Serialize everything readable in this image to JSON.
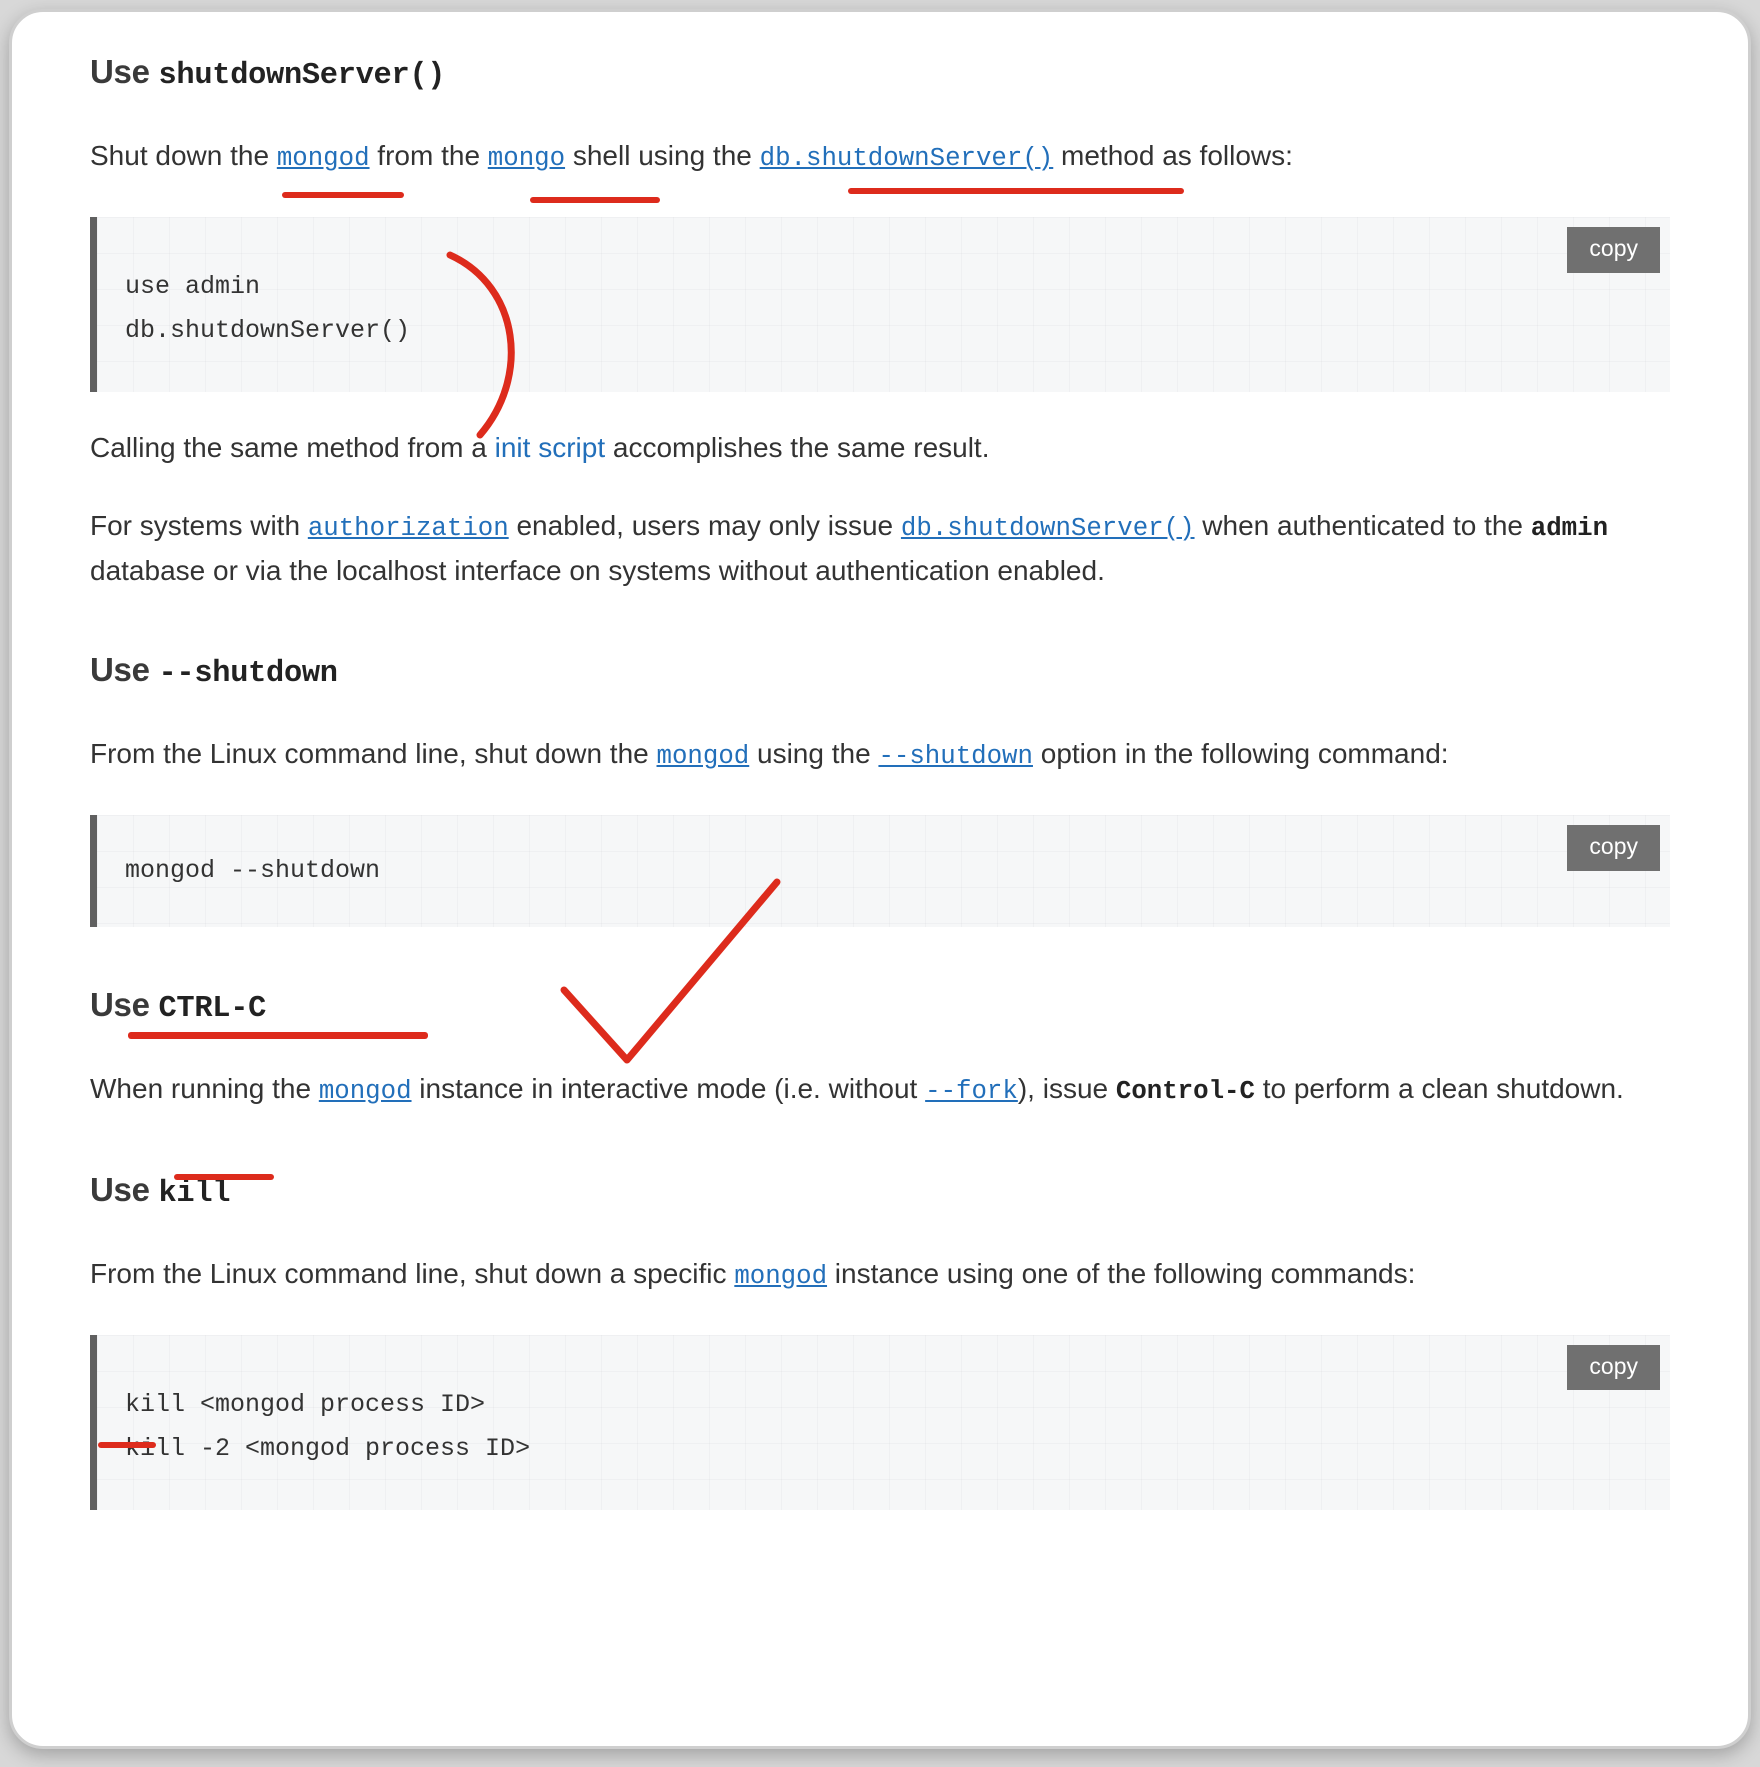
{
  "s1": {
    "h_pre": "Use ",
    "h_code": "shutdownServer()",
    "p1a": "Shut down the ",
    "p1_mongod": "mongod",
    "p1b": " from the ",
    "p1_mongo": "mongo",
    "p1c": " shell using the ",
    "p1_shut": "db.shutdownServer()",
    "p1d": " method as follows:",
    "code": "use admin\ndb.shutdownServer()",
    "copy": "copy",
    "p2a": "Calling the same method from a ",
    "p2_init": "init script",
    "p2b": " accomplishes the same result.",
    "p3a": "For systems with ",
    "p3_auth": "authorization",
    "p3b": " enabled, users may only issue ",
    "p3_shut": "db.shutdownServer()",
    "p3c": " when authenticated to the ",
    "p3_admin": "admin",
    "p3d": " database or via the localhost interface on systems without authentication enabled."
  },
  "s2": {
    "h_pre": "Use ",
    "h_code": "--shutdown",
    "p1a": "From the Linux command line, shut down the ",
    "p1_mongod": "mongod",
    "p1b": " using the ",
    "p1_shut": "--shutdown",
    "p1c": " option in the following command:",
    "code": "mongod --shutdown",
    "copy": "copy"
  },
  "s3": {
    "h_pre": "Use ",
    "h_code": "CTRL-C",
    "p1a": "When running the ",
    "p1_mongod": "mongod",
    "p1b": " instance in interactive mode (i.e. without ",
    "p1_fork": "--fork",
    "p1c": "), issue ",
    "p1_ctrlc": "Control-C",
    "p1d": " to perform a clean shutdown."
  },
  "s4": {
    "h_pre": "Use ",
    "h_code": "kill",
    "p1a": "From the Linux command line, shut down a specific ",
    "p1_mongod": "mongod",
    "p1b": " instance using one of the following commands:",
    "code": "kill <mongod process ID>\nkill -2 <mongod process ID>",
    "copy": "copy"
  }
}
